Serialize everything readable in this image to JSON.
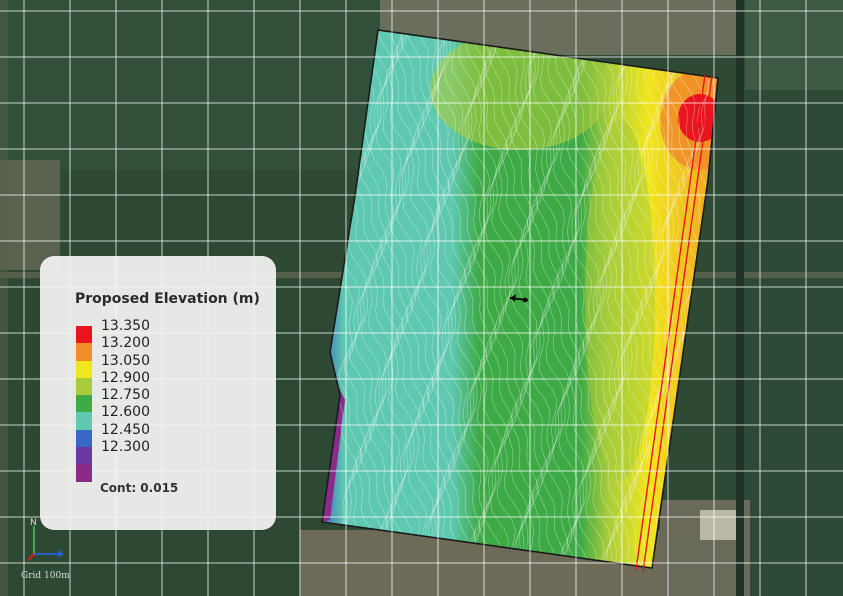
{
  "legend": {
    "title": "Proposed Elevation (m)",
    "entries": [
      {
        "label": "13.350",
        "color": "#e8141e"
      },
      {
        "label": "13.200",
        "color": "#f28c28"
      },
      {
        "label": "13.050",
        "color": "#f0e61e"
      },
      {
        "label": "12.900",
        "color": "#a8cc3a"
      },
      {
        "label": "12.750",
        "color": "#3daa46"
      },
      {
        "label": "12.600",
        "color": "#5ec8b0"
      },
      {
        "label": "12.450",
        "color": "#3a66c4"
      },
      {
        "label": "12.300",
        "color": "#6a3aa0"
      },
      {
        "label": "",
        "color": "#8a2a8a"
      }
    ],
    "contour_label": "Cont: 0.015"
  },
  "map": {
    "grid_label": "Grid 100m",
    "axis_north_label": "N",
    "colors": {
      "field_bg": "#2f4a34",
      "grid_line": "#ffffff",
      "boundary": "#1a1a1a",
      "pipe": "#e8141e",
      "contour": "#ffffff"
    }
  }
}
